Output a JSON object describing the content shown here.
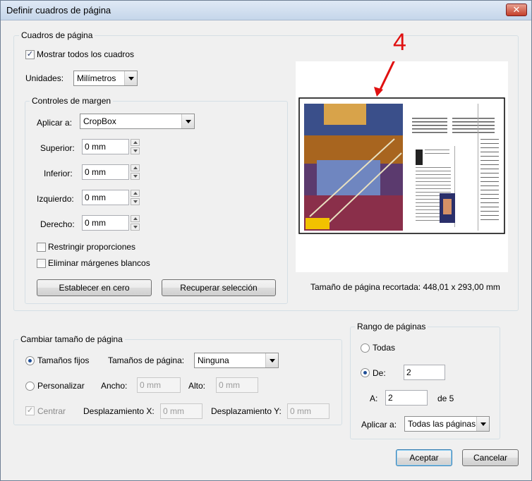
{
  "window": {
    "title": "Definir cuadros de página",
    "close_symbol": "✕"
  },
  "page_boxes": {
    "legend": "Cuadros de página",
    "show_all_label": "Mostrar todos los cuadros",
    "show_all_checked": true,
    "units_label": "Unidades:",
    "units_value": "Milímetros",
    "preview_number": "4",
    "size_text": "Tamaño de página recortada: 448,01 x 293,00 mm"
  },
  "margin_controls": {
    "legend": "Controles de margen",
    "apply_label": "Aplicar a:",
    "apply_value": "CropBox",
    "top_label": "Superior:",
    "top_value": "0 mm",
    "bottom_label": "Inferior:",
    "bottom_value": "0 mm",
    "left_label": "Izquierdo:",
    "left_value": "0 mm",
    "right_label": "Derecho:",
    "right_value": "0 mm",
    "constrain_label": "Restringir proporciones",
    "remove_white_label": "Eliminar márgenes blancos",
    "set_zero_label": "Establecer en cero",
    "revert_label": "Recuperar selección"
  },
  "resize": {
    "legend": "Cambiar tamaño de página",
    "fixed_label": "Tamaños fijos",
    "page_sizes_label": "Tamaños de página:",
    "page_sizes_value": "Ninguna",
    "custom_label": "Personalizar",
    "width_label": "Ancho:",
    "width_value": "0 mm",
    "height_label": "Alto:",
    "height_value": "0 mm",
    "center_label": "Centrar",
    "xoffset_label": "Desplazamiento X:",
    "xoffset_value": "0 mm",
    "yoffset_label": "Desplazamiento Y:",
    "yoffset_value": "0 mm"
  },
  "range": {
    "legend": "Rango de páginas",
    "all_label": "Todas",
    "from_label": "De:",
    "from_value": "2",
    "to_label": "A:",
    "to_value": "2",
    "of_text": "de 5",
    "apply_label": "Aplicar a:",
    "apply_value": "Todas las páginas"
  },
  "buttons": {
    "ok": "Aceptar",
    "cancel": "Cancelar"
  },
  "colors": {
    "arrow": "#e01010",
    "accent": "#1f4e96"
  }
}
